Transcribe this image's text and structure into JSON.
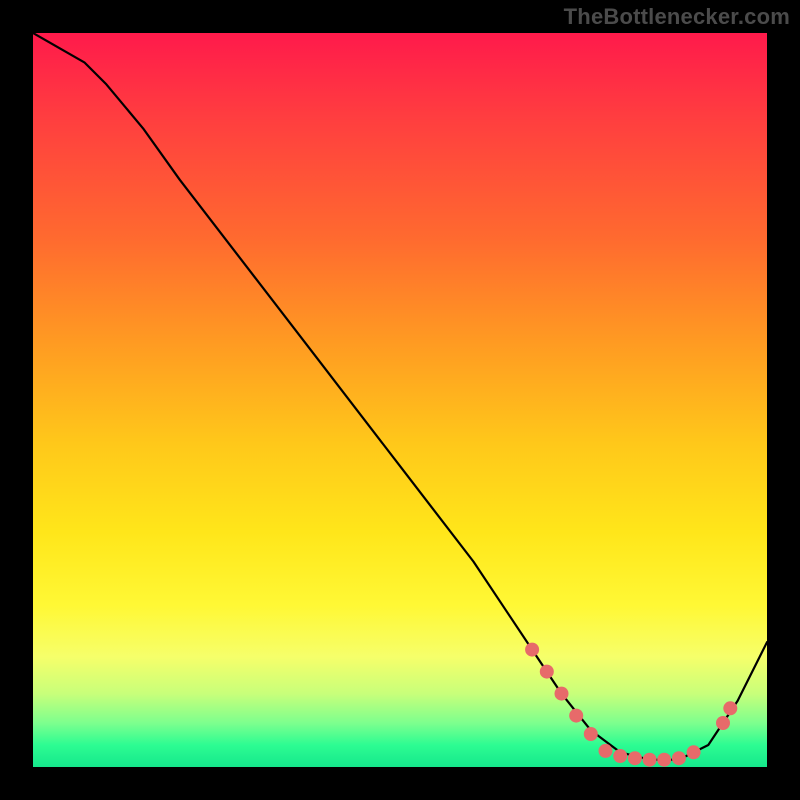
{
  "watermark": "TheBottlenecker.com",
  "chart_data": {
    "type": "line",
    "title": "",
    "xlabel": "",
    "ylabel": "",
    "xlim": [
      0,
      100
    ],
    "ylim": [
      0,
      100
    ],
    "grid": false,
    "legend": false,
    "series": [
      {
        "name": "curve",
        "x": [
          0,
          7,
          10,
          15,
          20,
          30,
          40,
          50,
          60,
          68,
          72,
          76,
          80,
          84,
          88,
          92,
          96,
          100
        ],
        "values": [
          100,
          96,
          93,
          87,
          80,
          67,
          54,
          41,
          28,
          16,
          10,
          5,
          2,
          1,
          1,
          3,
          9,
          17
        ]
      }
    ],
    "markers": [
      {
        "x": 68,
        "y": 16
      },
      {
        "x": 70,
        "y": 13
      },
      {
        "x": 72,
        "y": 10
      },
      {
        "x": 74,
        "y": 7
      },
      {
        "x": 76,
        "y": 4.5
      },
      {
        "x": 78,
        "y": 2.2
      },
      {
        "x": 80,
        "y": 1.5
      },
      {
        "x": 82,
        "y": 1.2
      },
      {
        "x": 84,
        "y": 1.0
      },
      {
        "x": 86,
        "y": 1.0
      },
      {
        "x": 88,
        "y": 1.2
      },
      {
        "x": 90,
        "y": 2.0
      },
      {
        "x": 94,
        "y": 6.0
      },
      {
        "x": 95,
        "y": 8.0
      }
    ],
    "colors": {
      "curve": "#000000",
      "marker": "#e76a6a"
    }
  }
}
